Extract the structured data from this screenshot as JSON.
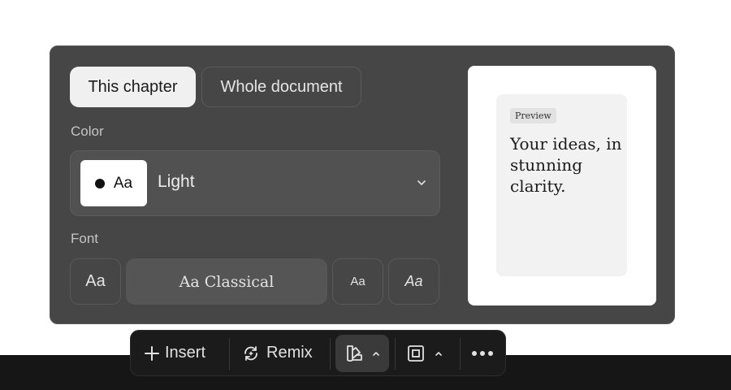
{
  "scope_tabs": {
    "active": "This chapter",
    "inactive": "Whole document"
  },
  "color": {
    "label": "Color",
    "swatch_text": "Aa",
    "selected": "Light"
  },
  "font": {
    "label": "Font",
    "options": [
      "Aa",
      "Aa  Classical",
      "Aa",
      "Aa"
    ],
    "selected": "Classical"
  },
  "preview": {
    "badge": "Preview",
    "text": "Your ideas, in stunning clarity."
  },
  "toolbar": {
    "insert": "Insert",
    "remix": "Remix"
  },
  "colors": {
    "panel_bg": "#464646",
    "toolbar_bg": "#1b1b1b",
    "active_tab_bg": "#f0f0f0"
  }
}
